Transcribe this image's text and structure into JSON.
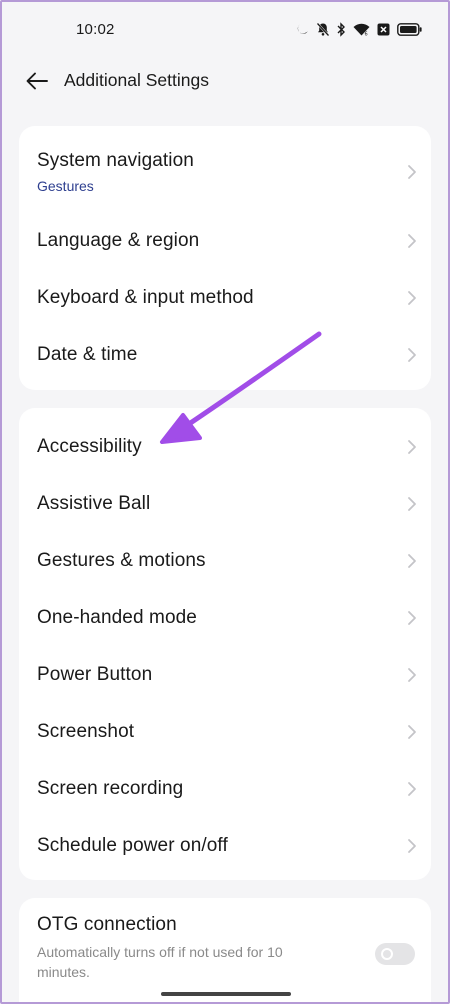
{
  "status_bar": {
    "time": "10:02",
    "icons": [
      "moon-icon",
      "bell-off-icon",
      "bluetooth-icon",
      "wifi-icon",
      "sim-x-icon",
      "battery-icon"
    ]
  },
  "header": {
    "title": "Additional Settings",
    "back_icon": "arrow-left-icon"
  },
  "groups": [
    {
      "items": [
        {
          "label": "System navigation",
          "sub": "Gestures"
        },
        {
          "label": "Language & region"
        },
        {
          "label": "Keyboard & input method"
        },
        {
          "label": "Date & time"
        }
      ]
    },
    {
      "items": [
        {
          "label": "Accessibility"
        },
        {
          "label": "Assistive Ball"
        },
        {
          "label": "Gestures & motions"
        },
        {
          "label": "One-handed mode"
        },
        {
          "label": "Power Button"
        },
        {
          "label": "Screenshot"
        },
        {
          "label": "Screen recording"
        },
        {
          "label": "Schedule power on/off"
        }
      ]
    }
  ],
  "otg": {
    "label": "OTG connection",
    "description": "Automatically turns off if not used for 10 minutes.",
    "enabled": false
  },
  "colors": {
    "accent_sub": "#2e3f8f",
    "annotation_arrow": "#a14de8",
    "background": "#f5f5f7",
    "card": "#ffffff"
  }
}
